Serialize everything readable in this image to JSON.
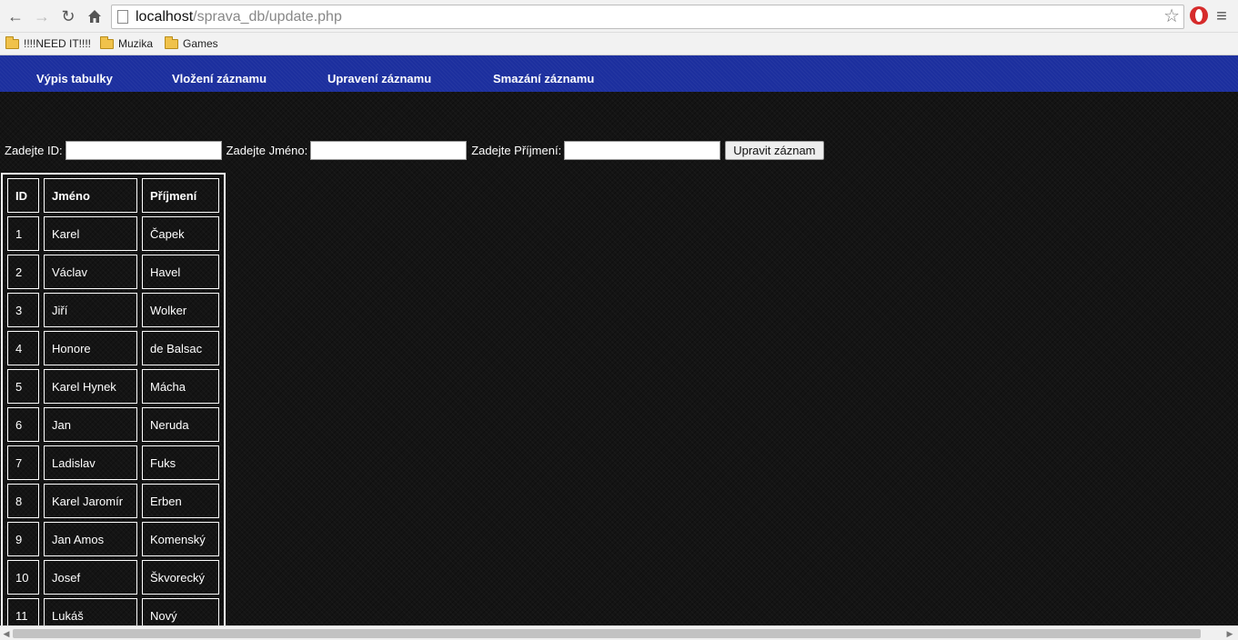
{
  "browser": {
    "url_host": "localhost",
    "url_path": "/sprava_db/update.php",
    "bookmarks": [
      "!!!!NEED IT!!!!",
      "Muzika",
      "Games"
    ]
  },
  "nav": {
    "items": [
      "Výpis tabulky",
      "Vložení záznamu",
      "Upravení záznamu",
      "Smazání záznamu"
    ]
  },
  "form": {
    "id_label": "Zadejte ID:",
    "name_label": "Zadejte Jméno:",
    "surname_label": "Zadejte Příjmení:",
    "id_value": "",
    "name_value": "",
    "surname_value": "",
    "submit_label": "Upravit záznam"
  },
  "table": {
    "headers": [
      "ID",
      "Jméno",
      "Příjmení"
    ],
    "rows": [
      [
        "1",
        "Karel",
        "Čapek"
      ],
      [
        "2",
        "Václav",
        "Havel"
      ],
      [
        "3",
        "Jiří",
        "Wolker"
      ],
      [
        "4",
        "Honore",
        "de Balsac"
      ],
      [
        "5",
        "Karel Hynek",
        "Mácha"
      ],
      [
        "6",
        "Jan",
        "Neruda"
      ],
      [
        "7",
        "Ladislav",
        "Fuks"
      ],
      [
        "8",
        "Karel Jaromír",
        "Erben"
      ],
      [
        "9",
        "Jan Amos",
        "Komenský"
      ],
      [
        "10",
        "Josef",
        "Škvorecký"
      ],
      [
        "11",
        "Lukáš",
        "Nový"
      ]
    ]
  },
  "colors": {
    "nav_bg": "#1c2f9e",
    "page_bg": "#141414",
    "text": "#ffffff"
  }
}
